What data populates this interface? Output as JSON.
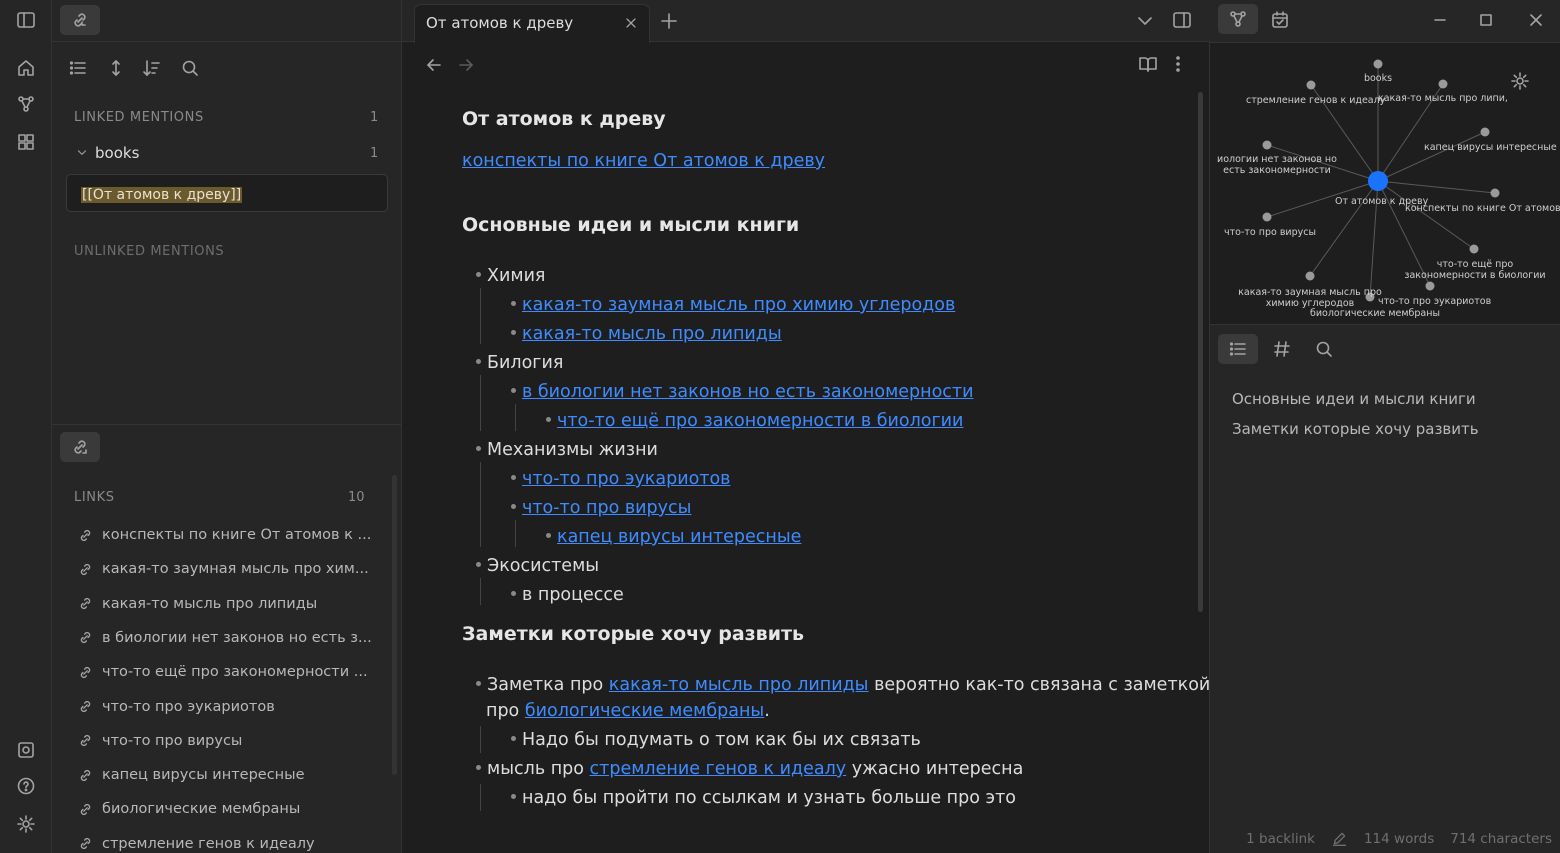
{
  "left": {
    "backlinks": {
      "linked_title": "LINKED MENTIONS",
      "linked_count": "1",
      "group_name": "books",
      "group_count": "1",
      "snippet": "[[От атомов к древу]]",
      "unlinked_title": "UNLINKED MENTIONS"
    },
    "links": {
      "title": "LINKS",
      "count": "10",
      "items": [
        "конспекты по книге От атомов к ...",
        "какая-то заумная мысль про хим...",
        "какая-то мысль про липиды",
        "в биологии нет законов но есть з...",
        "что-то ещё про закономерности ...",
        "что-то про эукариотов",
        "что-то про вирусы",
        "капец вирусы интересные",
        "биологические мембраны",
        "стремление генов к идеалу"
      ]
    }
  },
  "editor": {
    "tab_title": "От атомов к древу",
    "doc": {
      "title": "От атомов к древу",
      "top_link": "конспекты по книге От атомов к древу",
      "h2_ideas": "Основные идеи и мысли книги",
      "h2_notes": "Заметки которые хочу развить",
      "items": {
        "chem": "Химия",
        "chem1": "какая-то заумная мысль про химию углеродов",
        "chem2": "какая-то мысль про липиды",
        "bio": "Билогия",
        "bio1": "в биологии нет законов но есть закономерности",
        "bio1a": "что-то ещё про закономерности в биологии",
        "mech": "Механизмы жизни",
        "mech1": "что-то про эукариотов",
        "mech2": "что-то про вирусы",
        "mech2a": "капец вирусы интересные",
        "eco": "Экосистемы",
        "eco1": "в процессе"
      },
      "notes": {
        "n1_pre": "Заметка про ",
        "n1_link": "какая-то мысль про липиды",
        "n1_mid": " вероятно как-то связана с заметкой",
        "n1_pre2": "про ",
        "n1_link2": "биологические мембраны",
        "n1_end": ".",
        "n1a": "Надо бы подумать о том как бы их связать",
        "n2_pre": "мысль про ",
        "n2_link": "стремление генов к идеалу",
        "n2_end": " ужасно интересна",
        "n2a": "надо бы пройти по ссылкам и узнать больше про это"
      }
    }
  },
  "right": {
    "graph": {
      "center": "От атомов к древу",
      "nodes": {
        "books": "books",
        "genes": "стремление генов к идеалу",
        "lipids": "какая-то мысль про липи,",
        "bio_laws": "иологии нет законов но есть закономерности",
        "viruses_int": "капец вирусы интересные",
        "konspekt": "конспекты по книге От атомов к",
        "viruses": "что-то про вирусы",
        "more_bio": "что-то ещё про закономерности в биологии",
        "chem": "какая-то заумная мысль про химию углеродов",
        "euk": "что-то про эукариотов",
        "membr": "биологические мембраны"
      }
    },
    "outline": [
      "Основные идеи и мысли книги",
      "Заметки которые хочу развить"
    ],
    "status": {
      "backlinks": "1 backlink",
      "words": "114 words",
      "chars": "714 characters"
    }
  },
  "colors": {
    "accent": "#3e8cff",
    "node_center": "#1a73ff",
    "node": "#9a9a9a"
  }
}
